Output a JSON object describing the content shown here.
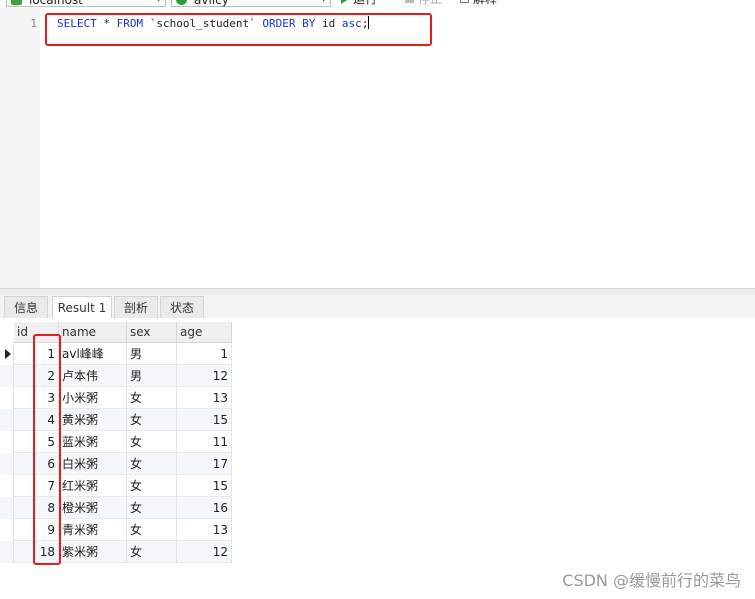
{
  "toolbar": {
    "connection": "localhost",
    "database": "avlicy",
    "run_label": "运行",
    "stop_label": "停止",
    "explain_label": "解释"
  },
  "editor": {
    "line_number": "1",
    "sql": {
      "select": "SELECT",
      "star": " * ",
      "from": "FROM",
      "table": " `school_student` ",
      "order_by": "ORDER BY",
      "col": " id ",
      "asc": "asc",
      "semi": ";"
    }
  },
  "tabs": [
    {
      "label": "信息"
    },
    {
      "label": "Result 1"
    },
    {
      "label": "剖析"
    },
    {
      "label": "状态"
    }
  ],
  "active_tab": "Result 1",
  "table": {
    "columns": [
      "id",
      "name",
      "sex",
      "age"
    ],
    "rows": [
      [
        "1",
        "avl峰峰",
        "男",
        "1"
      ],
      [
        "2",
        "卢本伟",
        "男",
        "12"
      ],
      [
        "3",
        "小米粥",
        "女",
        "13"
      ],
      [
        "4",
        "黄米粥",
        "女",
        "15"
      ],
      [
        "5",
        "蓝米粥",
        "女",
        "11"
      ],
      [
        "6",
        "白米粥",
        "女",
        "17"
      ],
      [
        "7",
        "红米粥",
        "女",
        "15"
      ],
      [
        "8",
        "橙米粥",
        "女",
        "16"
      ],
      [
        "9",
        "青米粥",
        "女",
        "13"
      ],
      [
        "18",
        "紫米粥",
        "女",
        "12"
      ]
    ],
    "selected_row": 0
  },
  "watermark": "CSDN @缓慢前行的菜鸟",
  "colors": {
    "keyword": "#1a35d6",
    "highlight_box": "#e02020"
  },
  "icons": {
    "connection": "connection-icon",
    "database": "database-icon",
    "run": "run-icon",
    "stop": "stop-icon",
    "explain": "explain-icon",
    "row_pointer": "row-pointer-icon"
  }
}
